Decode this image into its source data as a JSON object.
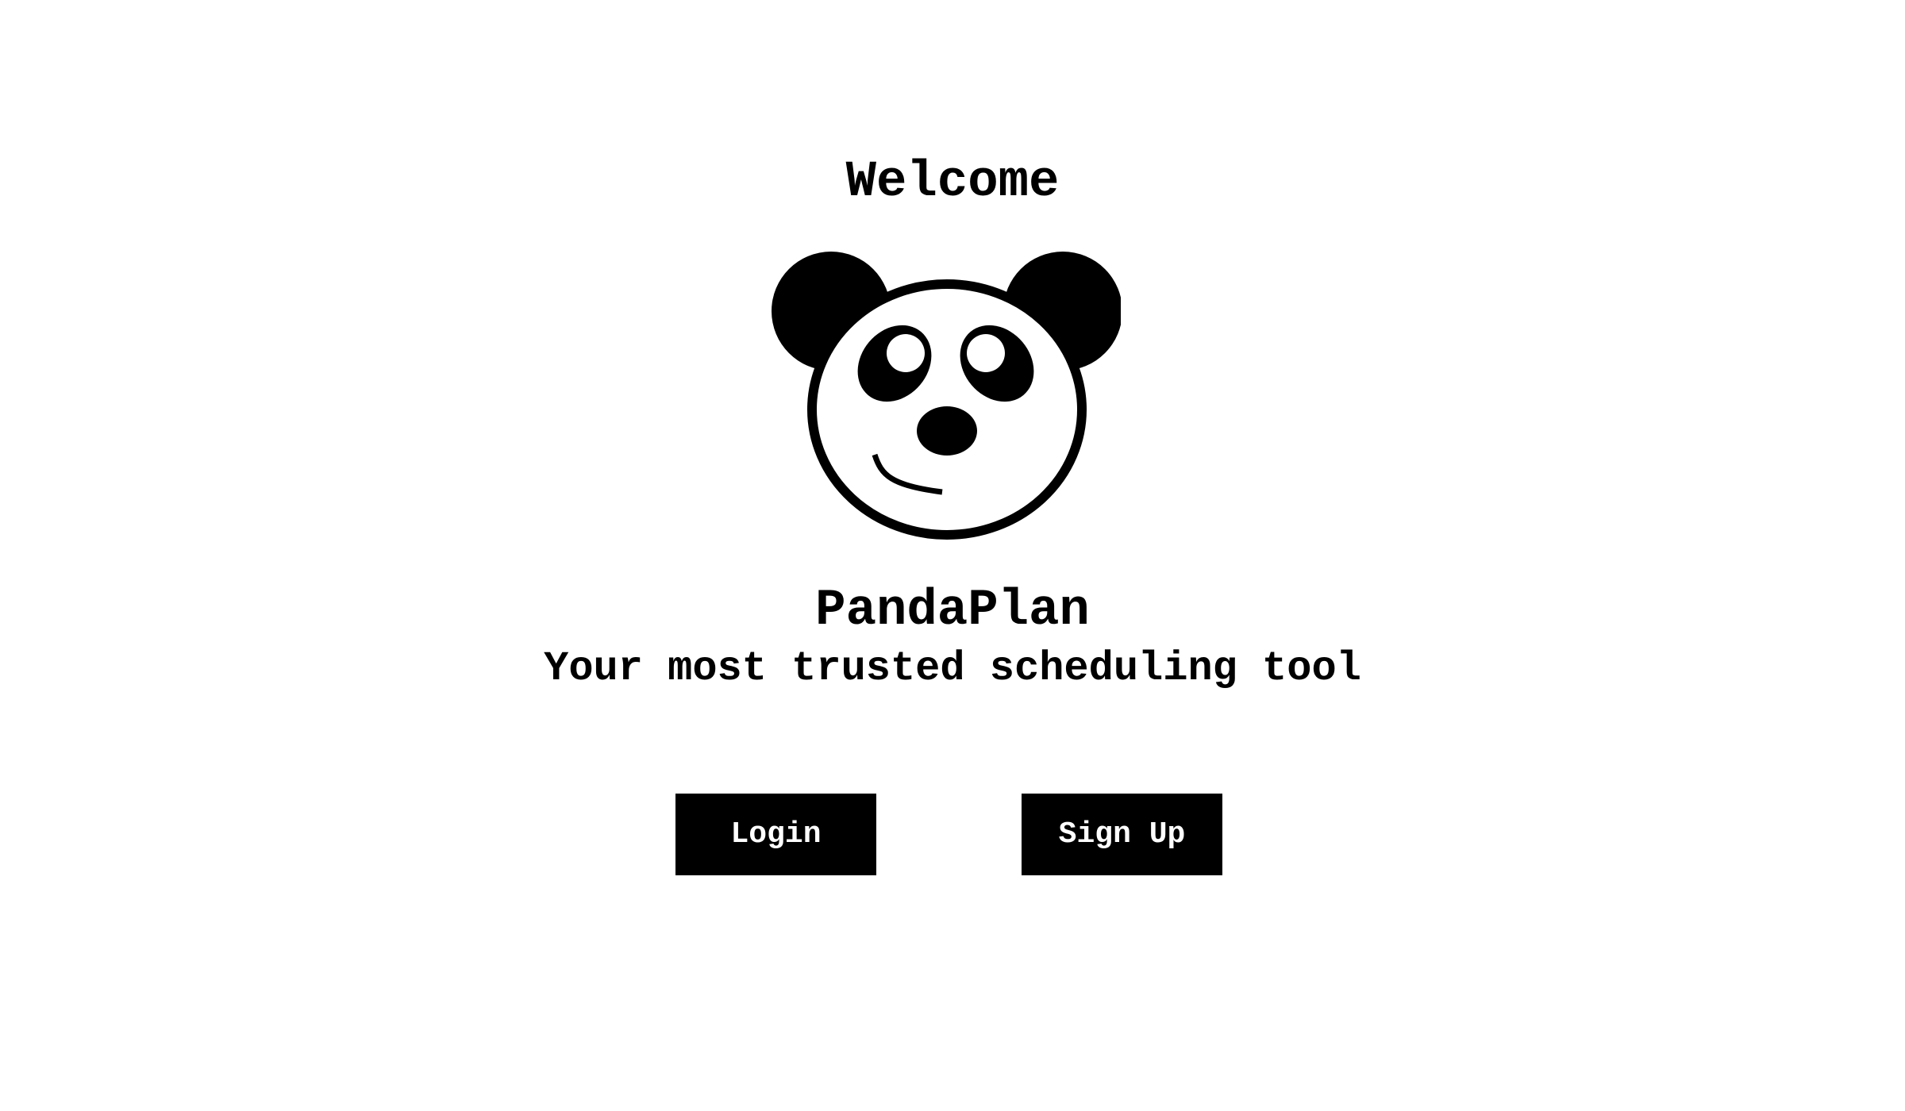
{
  "welcome_text": "Welcome",
  "logo": {
    "icon": "panda-icon",
    "colors": {
      "fill": "#000000",
      "face": "#ffffff"
    }
  },
  "app_name": "PandaPlan",
  "tagline": "Your most trusted scheduling tool",
  "buttons": {
    "login_label": "Login",
    "signup_label": "Sign Up"
  },
  "colors": {
    "background": "#ffffff",
    "text": "#000000",
    "button_background": "#000000",
    "button_text": "#ffffff"
  }
}
